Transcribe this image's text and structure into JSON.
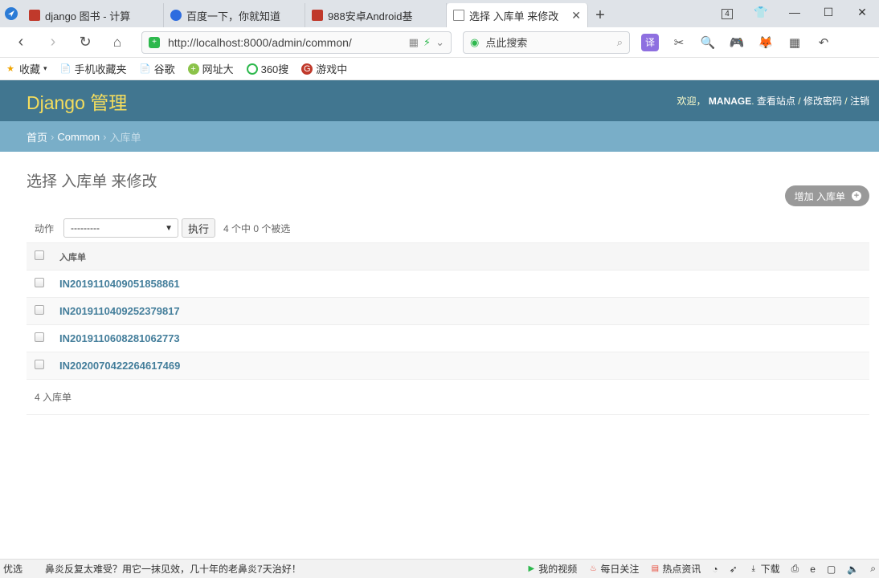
{
  "browser": {
    "tabs": [
      {
        "title": "django 图书 - 计算",
        "active": false
      },
      {
        "title": "百度一下，你就知道",
        "active": false
      },
      {
        "title": "988安卓Android基",
        "active": false
      },
      {
        "title": "选择 入库单 来修改",
        "active": true
      }
    ],
    "tab_count_badge": "4",
    "url": "http://localhost:8000/admin/common/",
    "search_placeholder": "点此搜索",
    "bookmarks": [
      "收藏",
      "手机收藏夹",
      "谷歌",
      "网址大",
      "360搜",
      "游戏中"
    ]
  },
  "admin": {
    "brand": "Django 管理",
    "welcome": "欢迎，",
    "username": "MANAGE",
    "links": [
      "查看站点",
      "修改密码",
      "注销"
    ],
    "breadcrumbs": [
      "首页",
      "Common",
      "入库单"
    ],
    "page_title": "选择 入库单 来修改",
    "add_button": "增加 入库单",
    "actions_label": "动作",
    "select_value": "---------",
    "go_button": "执行",
    "counter": "4 个中 0 个被选",
    "column_header": "入库单",
    "rows": [
      "IN2019110409051858861",
      "IN2019110409252379817",
      "IN2019110608281062773",
      "IN2020070422264617469"
    ],
    "paginator": "4 入库单"
  },
  "statusbar": {
    "left": "优选",
    "news": "鼻炎反复太难受？用它一抹见效，几十年的老鼻炎7天治好！",
    "items": [
      "我的视频",
      "每日关注",
      "热点资讯",
      "下载"
    ]
  },
  "colors": {
    "header": "#417690",
    "breadcrumbs": "#79aec8",
    "brand": "#f5dd5d",
    "link": "#447e9b"
  }
}
